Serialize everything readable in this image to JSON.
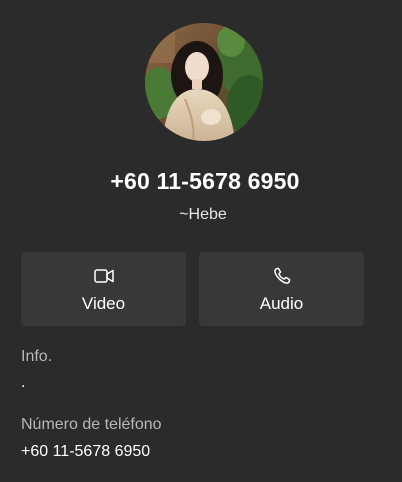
{
  "contact": {
    "phone_title": "+60 11-5678 6950",
    "push_name": "~Hebe"
  },
  "actions": {
    "video_label": "Video",
    "video_icon": "video-camera-icon",
    "audio_label": "Audio",
    "audio_icon": "phone-icon"
  },
  "info": {
    "label": "Info.",
    "value": "."
  },
  "phone_number": {
    "label": "Número de teléfono",
    "value": "+60 11-5678 6950"
  },
  "colors": {
    "background": "#2b2b2b",
    "button_background": "#383838",
    "secondary_text": "#b8b8b8",
    "primary_text": "#ffffff"
  }
}
